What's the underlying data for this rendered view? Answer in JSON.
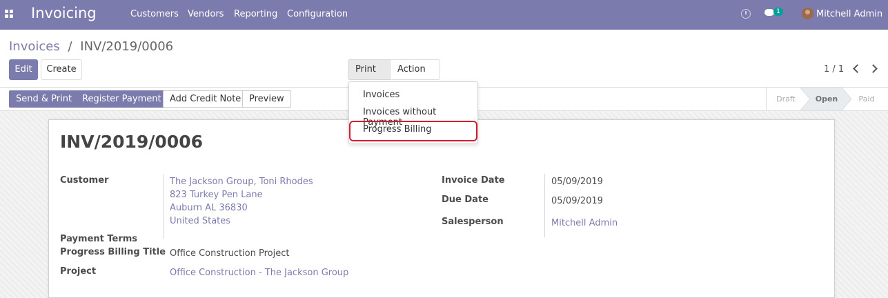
{
  "nav": {
    "brand": "Invoicing",
    "menu": [
      "Customers",
      "Vendors",
      "Reporting",
      "Configuration"
    ],
    "chat_badge": "1",
    "user": "Mitchell Admin"
  },
  "breadcrumb": {
    "parent": "Invoices",
    "separator": "/",
    "current": "INV/2019/0006"
  },
  "toolbar": {
    "edit": "Edit",
    "create": "Create",
    "print": "Print",
    "action": "Action"
  },
  "pager": {
    "value": "1 / 1"
  },
  "statusbar": {
    "buttons": [
      "Send & Print",
      "Register Payment",
      "Add Credit Note",
      "Preview"
    ],
    "stages": [
      "Draft",
      "Open",
      "Paid"
    ],
    "active_stage": "Open"
  },
  "print_menu": {
    "items": [
      "Invoices",
      "Invoices without Payment",
      "Progress Billing"
    ],
    "highlighted": "Progress Billing"
  },
  "invoice": {
    "title": "INV/2019/0006",
    "customer_label": "Customer",
    "customer_lines": [
      "The Jackson Group, Toni Rhodes",
      "823 Turkey Pen Lane",
      "Auburn AL 36830",
      "United States"
    ],
    "payment_terms_label": "Payment Terms",
    "progress_title_label": "Progress Billing Title",
    "progress_title_value": "Office Construction Project",
    "project_label": "Project",
    "project_value": "Office Construction - The Jackson Group",
    "invoice_date_label": "Invoice Date",
    "invoice_date_value": "05/09/2019",
    "due_date_label": "Due Date",
    "due_date_value": "05/09/2019",
    "salesperson_label": "Salesperson",
    "salesperson_value": "Mitchell Admin"
  },
  "colors": {
    "brand": "#7c7bad",
    "highlight": "#d11f2f"
  }
}
